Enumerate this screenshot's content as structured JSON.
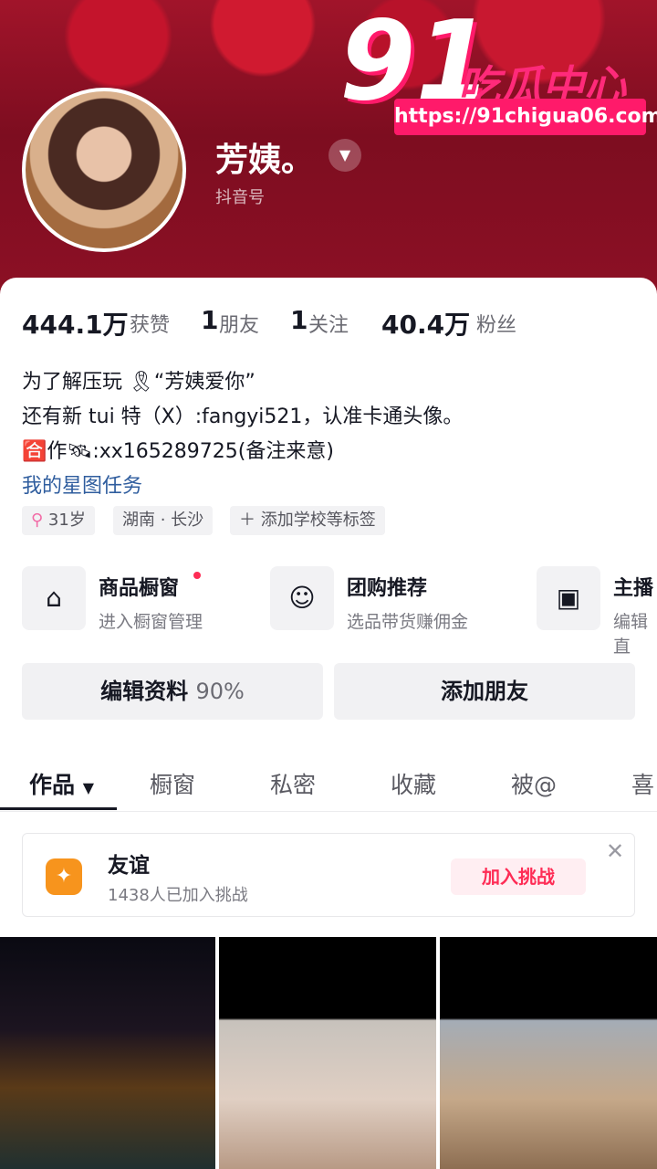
{
  "watermark": {
    "number": "91",
    "name": "吃瓜中心",
    "url": "https://91chigua06.com"
  },
  "profile": {
    "username": "芳姨。",
    "douyin_id": "抖音号"
  },
  "stats": [
    {
      "value": "444.1万",
      "label": "获赞"
    },
    {
      "value": "1",
      "label": "朋友"
    },
    {
      "value": "1",
      "label": "关注"
    },
    {
      "value": "40.4万",
      "label": "粉丝"
    }
  ],
  "bio": {
    "line1": "为了解压玩 🎗“芳姨爱你”",
    "line2": "还有新 tui 特（X）:fangyi521，认准卡通头像。",
    "line3": "🈴作🛰:xx165289725(备注来意)",
    "link": "我的星图任务"
  },
  "tags": [
    {
      "label": "31岁",
      "icon": "female-icon"
    },
    {
      "label": "湖南 · 长沙"
    },
    {
      "label": "添加学校等标签",
      "icon": "plus-icon"
    }
  ],
  "features": [
    {
      "title": "商品橱窗",
      "subtitle": "进入橱窗管理",
      "icon": "store-icon"
    },
    {
      "title": "团购推荐",
      "subtitle": "选品带货赚佣金",
      "icon": "basket-icon"
    },
    {
      "title": "主播",
      "subtitle": "编辑直",
      "icon": "tv-icon"
    }
  ],
  "buttons": {
    "edit_label": "编辑资料",
    "edit_progress": "90%",
    "add_friend": "添加朋友"
  },
  "tabs": [
    "作品",
    "橱窗",
    "私密",
    "收藏",
    "被@",
    "喜"
  ],
  "challenge": {
    "title": "友谊",
    "subtitle": "1438人已加入挑战",
    "button": "加入挑战"
  }
}
